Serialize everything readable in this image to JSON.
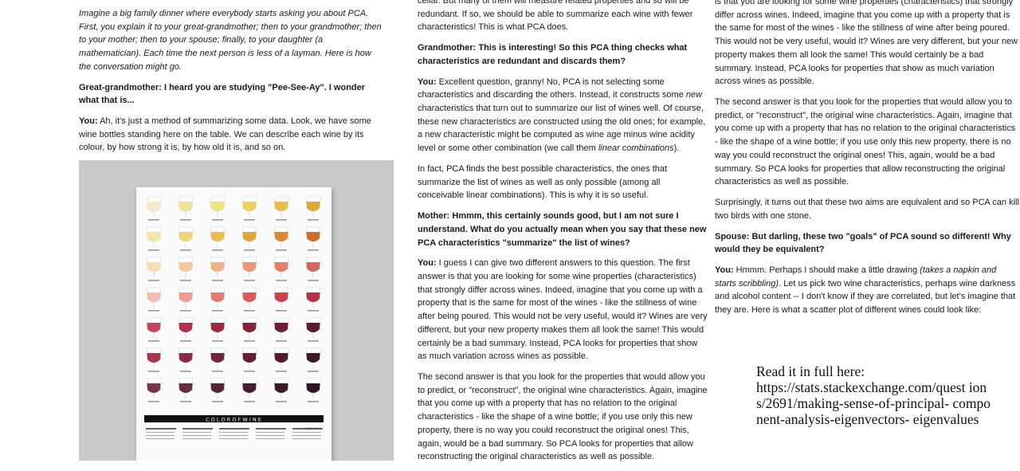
{
  "col1": {
    "intro": "Imagine a big family dinner where everybody starts asking you about PCA. First, you explain it to your great-grandmother; then to your grandmother; then to your mother; then to your spouse; finally, to your daughter (a mathematician). Each time the next person is less of a layman. Here is how the conversation might go.",
    "q1": "Great-grandmother: I heard you are studying \"Pee-See-Ay\". I wonder what that is...",
    "a1_speaker": "You:",
    "a1_text": " Ah, it's just a method of summarizing some data. Look, we have some wine bottles standing here on the table. We can describe each wine by its colour, by how strong it is, by how old it is, and so on."
  },
  "poster": {
    "title": "C O L O R   O F   W I N E",
    "brand": "WINE FOLLY",
    "glasses": [
      [
        "#f2eccb",
        "#efe39a",
        "#f1e47f",
        "#edd25a",
        "#e4c046",
        "#d8ab35"
      ],
      [
        "#f3e6a5",
        "#eed57a",
        "#e8bf55",
        "#e2a43e",
        "#d98b34",
        "#c86f2f"
      ],
      [
        "#f5dfb6",
        "#f3c89c",
        "#efb08a",
        "#ea977a",
        "#e0816b",
        "#cf6a60"
      ],
      [
        "#f1c0b5",
        "#ec9c94",
        "#e47a74",
        "#da5c5f",
        "#c8444f",
        "#b13344"
      ],
      [
        "#c8435c",
        "#b2314c",
        "#9b2a44",
        "#86233c",
        "#6f1f35",
        "#5c1a2f"
      ],
      [
        "#a8344e",
        "#8e2a45",
        "#78233d",
        "#631d36",
        "#511a31",
        "#40162b"
      ],
      [
        "#7a3447",
        "#682b3f",
        "#562437",
        "#461e30",
        "#3a1a2b",
        "#2e1525"
      ]
    ]
  },
  "col2": {
    "top_text": "cellar. But many of them will measure related properties and so will be redundant. If so, we should be able to summarize each wine with fewer characteristics! This is what PCA does.",
    "q2": "Grandmother: This is interesting! So this PCA thing checks what characteristics are redundant and discards them?",
    "a2_speaker": "You:",
    "a2_text_a": " Excellent question, granny! No, PCA is not selecting some characteristics and discarding the others. Instead, it constructs some ",
    "a2_new": "new",
    "a2_text_b": " characteristics that turn out to summarize our list of wines well. Of course, these new characteristics are constructed using the old ones; for example, a new characteristic might be computed as wine age minus wine acidity level or some other combination (we call them ",
    "a2_lc": "linear combinations",
    "a2_text_c": ").",
    "a2b": "In fact, PCA finds the best possible characteristics, the ones that summarize the list of wines as well as only possible (among all conceivable linear combinations). This is why it is so useful.",
    "q3": "Mother: Hmmm, this certainly sounds good, but I am not sure I understand. What do you actually mean when you say that these new PCA characteristics \"summarize\" the list of wines?",
    "a3_speaker": "You:",
    "a3_text": " I guess I can give two different answers to this question. The first answer is that you are looking for some wine properties (characteristics) that strongly differ across wines. Indeed, imagine that you come up with a property that is the same for most of the wines - like the stillness of wine after being poured. This would not be very useful, would it? Wines are very different, but your new property makes them all look the same! This would certainly be a bad summary. Instead, PCA looks for properties that show as much variation across wines as possible.",
    "a3b": "The second answer is that you look for the properties that would allow you to predict, or \"reconstruct\", the original wine characteristics. Again, imagine that you come up with a property that has no relation to the original characteristics - like the shape of a wine bottle; if you use only this new property, there is no way you could reconstruct the original ones! This, again, would be a bad summary. So PCA looks for properties that allow reconstructing the original characteristics as well as possible."
  },
  "col3": {
    "top_text": "is that you are looking for some wine properties (characteristics) that strongly differ across wines. Indeed, imagine that you come up with a property that is the same for most of the wines - like the stillness of wine after being poured. This would not be very useful, would it? Wines are very different, but your new property makes them all look the same! This would certainly be a bad summary. Instead, PCA looks for properties that show as much variation across wines as possible.",
    "p2": "The second answer is that you look for the properties that would allow you to predict, or \"reconstruct\", the original wine characteristics. Again, imagine that you come up with a property that has no relation to the original characteristics - like the shape of a wine bottle; if you use only this new property, there is no way you could reconstruct the original ones! This, again, would be a bad summary. So PCA looks for properties that allow reconstructing the original characteristics as well as possible.",
    "p3": "Surprisingly, it turns out that these two aims are equivalent and so PCA can kill two birds with one stone.",
    "q4": "Spouse: But darling, these two \"goals\" of PCA sound so different! Why would they be equivalent?",
    "a4_speaker": "You:",
    "a4_text_a": " Hmmm. Perhaps I should make a little drawing ",
    "a4_it": "(takes a napkin and starts scribbling)",
    "a4_text_b": ". Let us pick two wine characteristics, perhaps wine darkness and alcohol content -- I don't know if they are correlated, but let's imagine that they are. Here is what a scatter plot of different wines could look like:"
  },
  "readmore": {
    "label": "Read it in full here:",
    "url": "https://stats.stackexchange.com/questions/2691/making-sense-of-principal-component-analysis-eigenvectors-eigenvalues",
    "url_display": "https://stats.stackexchange.com/quest ions/2691/making-sense-of-principal- component-analysis-eigenvectors- eigenvalues"
  }
}
